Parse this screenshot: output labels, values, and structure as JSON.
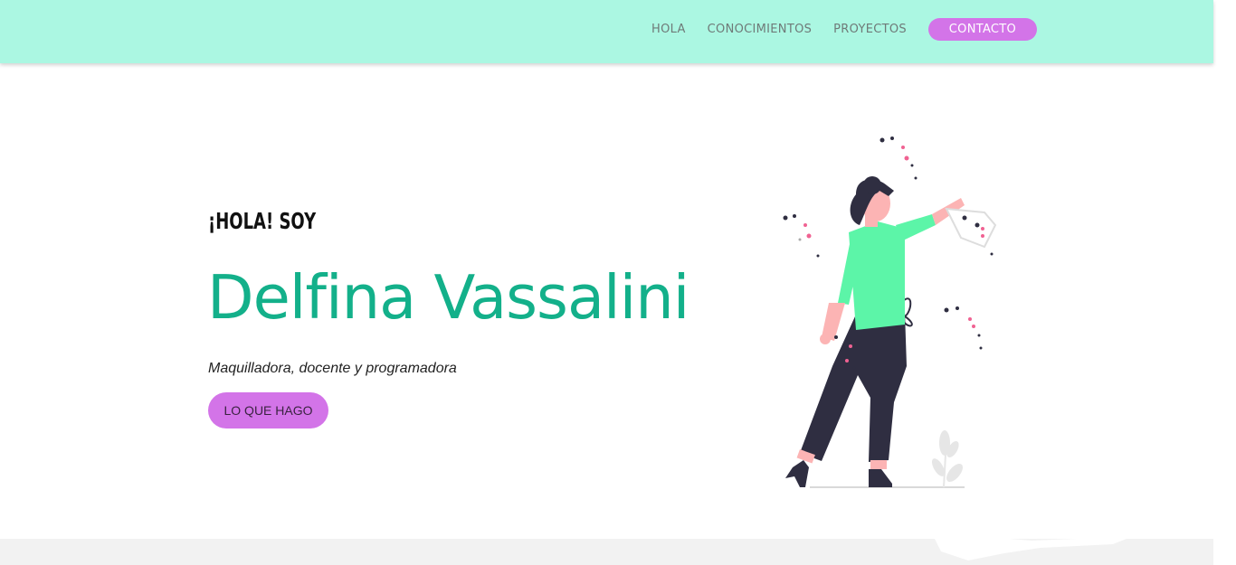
{
  "nav": {
    "links": [
      {
        "label": "HOLA"
      },
      {
        "label": "CONOCIMIENTOS"
      },
      {
        "label": "PROYECTOS"
      }
    ],
    "contact_label": "CONTACTO"
  },
  "hero": {
    "kicker": "¡HOLA! SOY",
    "name": "Delfina Vassalini",
    "subtitle": "Maquilladora, docente y programadora",
    "button_label": "LO QUE HAGO"
  },
  "colors": {
    "navbar_bg": "#abf7e2",
    "accent_purple": "#d374e8",
    "name_green": "#13b08a",
    "shirt_green": "#5cf5a8",
    "pants_dark": "#2f2e41",
    "skin": "#fcb4b4",
    "sparkle_pink": "#f06292"
  },
  "illustration": {
    "icon": "woman-throwing-confetti-illustration"
  }
}
